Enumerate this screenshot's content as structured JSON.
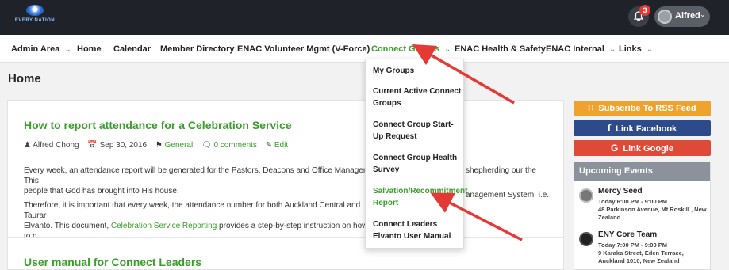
{
  "header": {
    "logo_text": "EVERY NATION",
    "notification_count": "3",
    "user_name": "Alfred"
  },
  "nav": {
    "items": [
      {
        "label": "Admin Area",
        "dropdown": true
      },
      {
        "label": "Home",
        "dropdown": false
      },
      {
        "label": "Calendar",
        "dropdown": false
      },
      {
        "label": "Member Directory",
        "dropdown": false
      },
      {
        "label": "ENAC Volunteer Mgmt (V-Force)",
        "dropdown": true
      },
      {
        "label": "Connect Groups",
        "dropdown": true,
        "active": true
      },
      {
        "label": "ENAC Health & Safety",
        "dropdown": false
      },
      {
        "label": "ENAC Internal",
        "dropdown": true
      },
      {
        "label": "Links",
        "dropdown": true
      }
    ]
  },
  "page": {
    "title": "Home"
  },
  "dropdown": {
    "items": [
      {
        "label": "My Groups"
      },
      {
        "label": "Current Active Connect Groups"
      },
      {
        "label": "Connect Group Start-Up Request"
      },
      {
        "label": "Connect Group Health Survey"
      },
      {
        "label": "Salvation/Recommitment Report",
        "active": true
      },
      {
        "label": "Connect Leaders Elvanto User Manual"
      }
    ]
  },
  "post": {
    "title": "How to report attendance for a Celebration Service",
    "author": "Alfred Chong",
    "date": "Sep 30, 2016",
    "category": "General",
    "comments": "0 comments",
    "edit": "Edit",
    "p1_left": "Every week, an attendance report will be generated for the Pastors, Deacons and Office Manager.  This",
    "p1_left2": "people that God has brought into His house.",
    "p1_right": "shepherding our the",
    "p2_left": "Therefore, it is important that every week, the attendance number for both Auckland Central and Taurar",
    "p2_left2_a": "Elvanto.  This document, ",
    "p2_link": "Celebration Service Reporting",
    "p2_left2_b": " provides a step-by-step instruction on how to d",
    "p2_right": "anagement System, i.e."
  },
  "post2": {
    "title": "User manual for Connect Leaders"
  },
  "sidebar": {
    "rss": "Subscribe To RSS Feed",
    "facebook": "Link Facebook",
    "google": "Link Google",
    "events_title": "Upcoming Events",
    "events": [
      {
        "name": "Mercy Seed",
        "time": "Today 6:00 PM - 9:00 PM",
        "address": "48 Parkinson Avenue, Mt Roskill , New Zealand"
      },
      {
        "name": "ENY Core Team",
        "time": "Today 7:00 PM - 9:00 PM",
        "address": "9 Karaka Street, Eden Terrace, Auckland 1010, New Zealand"
      }
    ]
  },
  "colors": {
    "accent": "#3a9d2c",
    "arrow": "#e53935",
    "rss": "#f0a22e",
    "facebook": "#2d4a8a",
    "google": "#df4a38"
  }
}
